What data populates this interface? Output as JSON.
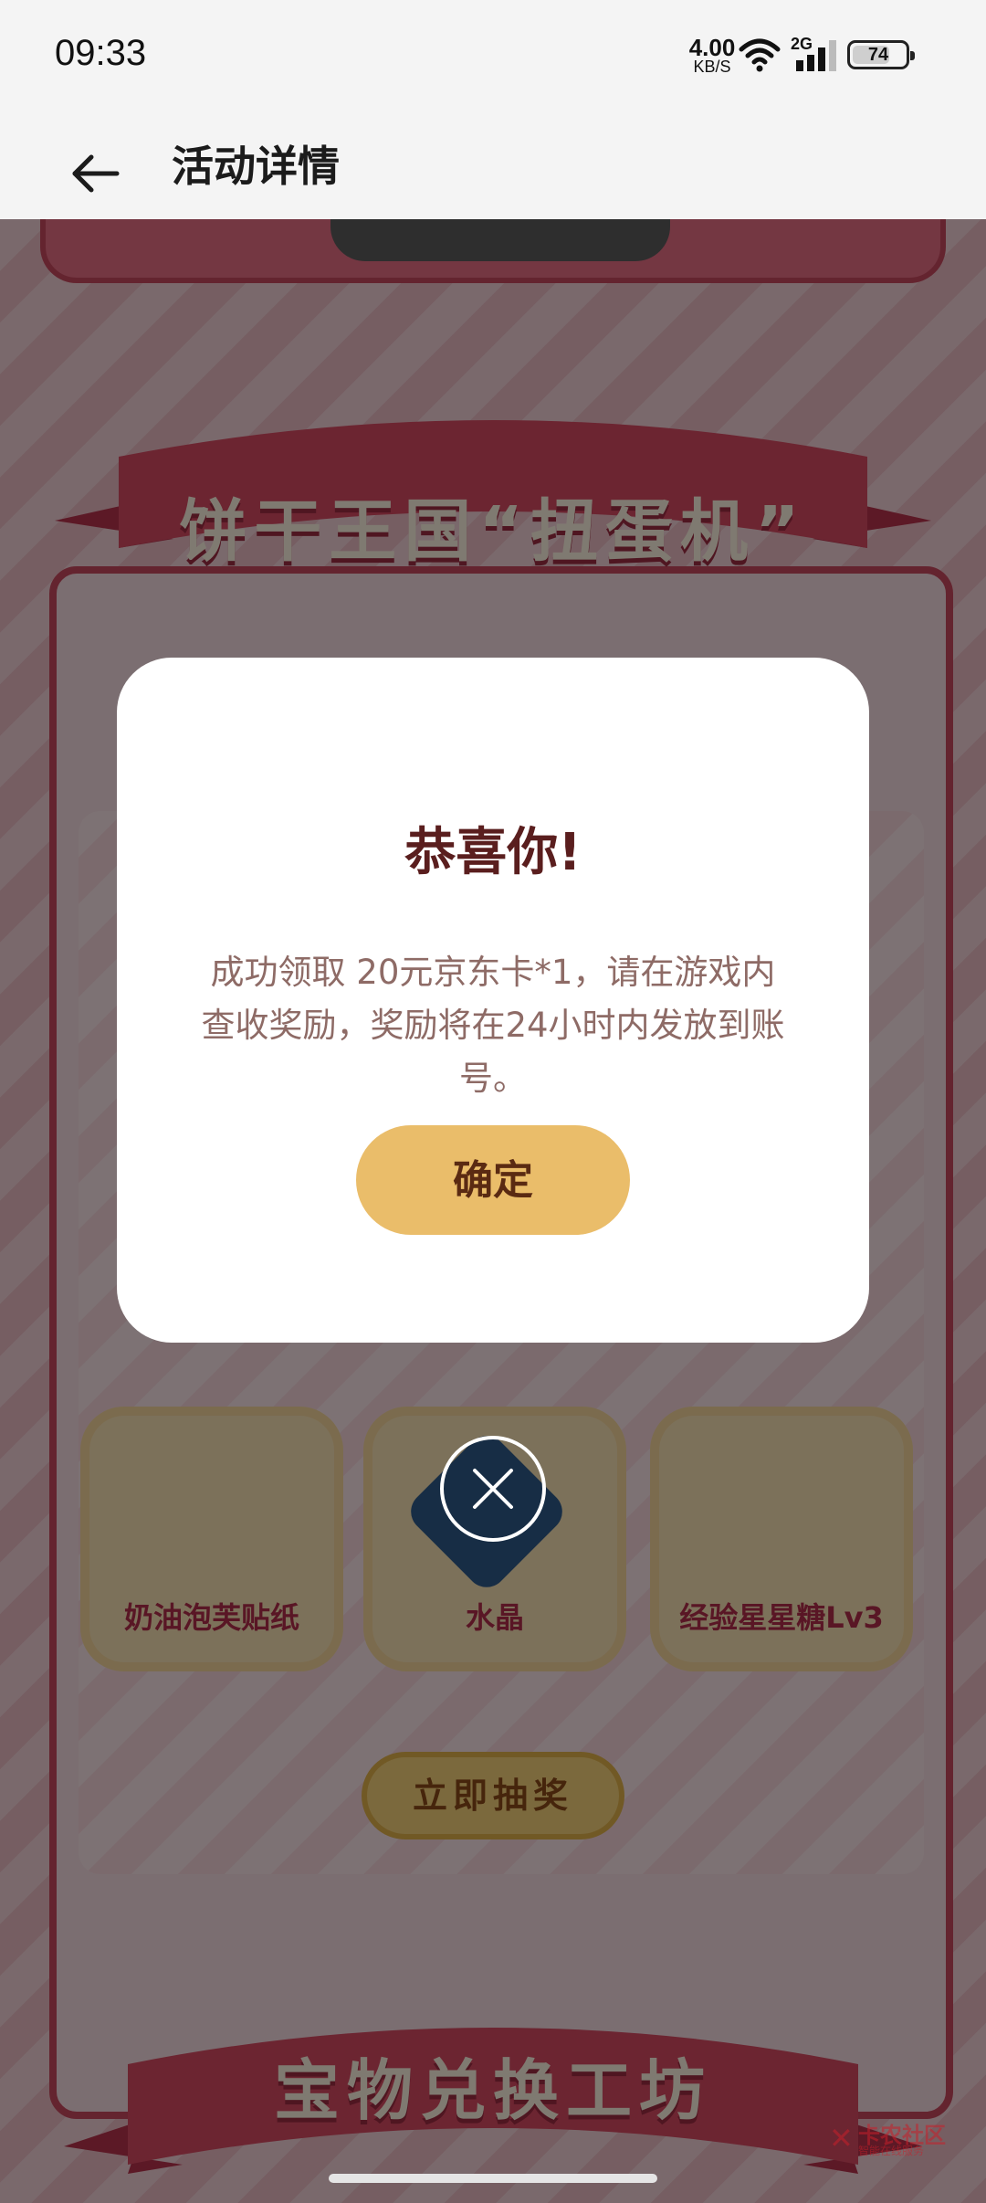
{
  "status_bar": {
    "time": "09:33",
    "net_speed_value": "4.00",
    "net_speed_unit": "KB/S",
    "network_type": "2G",
    "battery": "74",
    "battery_level": 0.74
  },
  "header": {
    "title": "活动详情"
  },
  "background": {
    "section_title": "饼干王国“扭蛋机”",
    "prize_labels": [
      "奶油泡芙贴纸",
      "水晶",
      "经验星星糖Lv3"
    ],
    "draw_button_label": "立即抽奖",
    "bottom_section_title": "宝物兑换工坊"
  },
  "dialog": {
    "title": "恭喜你!",
    "message": "成功领取 20元京东卡*1，请在游戏内查收奖励，奖励将在24小时内发放到账号。",
    "confirm_label": "确定"
  },
  "watermark": {
    "text": "卡农社区",
    "subtext": "智能在线服务"
  },
  "colors": {
    "accent": "#eabd6a",
    "dialog_title": "#5a1e1e",
    "dialog_text": "#8e6b66",
    "panel_border": "#c9485f"
  }
}
